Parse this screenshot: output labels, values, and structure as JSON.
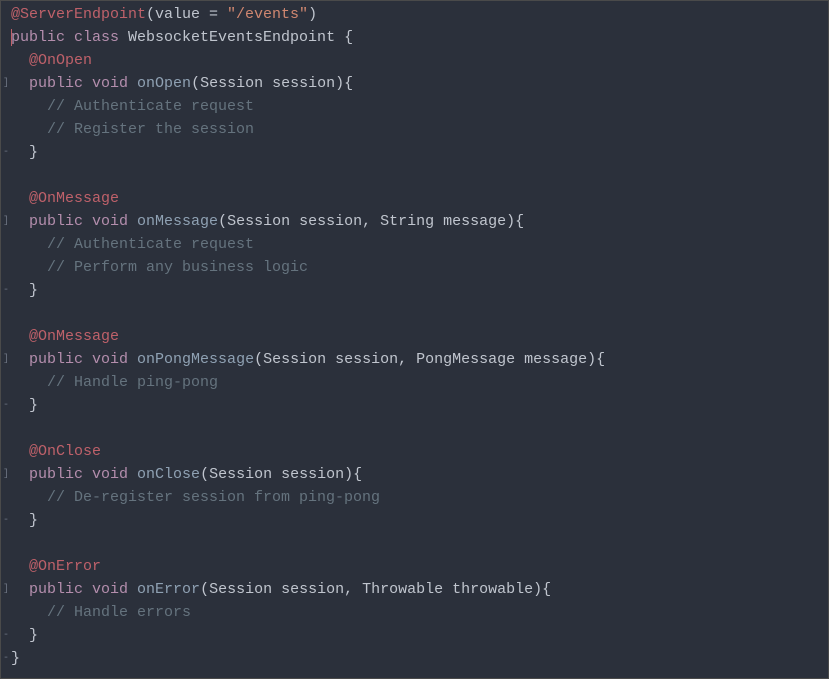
{
  "code": {
    "lines": [
      {
        "tokens": [
          {
            "cls": "tok-annot",
            "t": "@ServerEndpoint"
          },
          {
            "cls": "tok-punct",
            "t": "(value = "
          },
          {
            "cls": "tok-str",
            "t": "\"/events\""
          },
          {
            "cls": "tok-punct",
            "t": ")"
          }
        ],
        "gutter": ""
      },
      {
        "tokens": [
          {
            "cls": "tok-kw",
            "t": "public class "
          },
          {
            "cls": "tok-type",
            "t": "WebsocketEventsEndpoint "
          },
          {
            "cls": "tok-punct",
            "t": "{"
          }
        ],
        "gutter": "",
        "cursor": true
      },
      {
        "tokens": [
          {
            "cls": "tok-annot",
            "t": "  @OnOpen"
          }
        ],
        "gutter": ""
      },
      {
        "tokens": [
          {
            "cls": "tok-punct",
            "t": "  "
          },
          {
            "cls": "tok-kw",
            "t": "public void "
          },
          {
            "cls": "tok-method",
            "t": "onOpen"
          },
          {
            "cls": "tok-punct",
            "t": "(Session session){"
          }
        ],
        "gutter": "]"
      },
      {
        "tokens": [
          {
            "cls": "tok-comment",
            "t": "    // Authenticate request"
          }
        ],
        "gutter": ""
      },
      {
        "tokens": [
          {
            "cls": "tok-comment",
            "t": "    // Register the session"
          }
        ],
        "gutter": ""
      },
      {
        "tokens": [
          {
            "cls": "tok-punct",
            "t": "  }"
          }
        ],
        "gutter": "-"
      },
      {
        "tokens": [
          {
            "cls": "tok-punct",
            "t": ""
          }
        ],
        "gutter": ""
      },
      {
        "tokens": [
          {
            "cls": "tok-annot",
            "t": "  @OnMessage"
          }
        ],
        "gutter": ""
      },
      {
        "tokens": [
          {
            "cls": "tok-punct",
            "t": "  "
          },
          {
            "cls": "tok-kw",
            "t": "public void "
          },
          {
            "cls": "tok-method",
            "t": "onMessage"
          },
          {
            "cls": "tok-punct",
            "t": "(Session session, String message){"
          }
        ],
        "gutter": "]"
      },
      {
        "tokens": [
          {
            "cls": "tok-comment",
            "t": "    // Authenticate request"
          }
        ],
        "gutter": ""
      },
      {
        "tokens": [
          {
            "cls": "tok-comment",
            "t": "    // Perform any business logic"
          }
        ],
        "gutter": ""
      },
      {
        "tokens": [
          {
            "cls": "tok-punct",
            "t": "  }"
          }
        ],
        "gutter": "-"
      },
      {
        "tokens": [
          {
            "cls": "tok-punct",
            "t": ""
          }
        ],
        "gutter": ""
      },
      {
        "tokens": [
          {
            "cls": "tok-annot",
            "t": "  @OnMessage"
          }
        ],
        "gutter": ""
      },
      {
        "tokens": [
          {
            "cls": "tok-punct",
            "t": "  "
          },
          {
            "cls": "tok-kw",
            "t": "public void "
          },
          {
            "cls": "tok-method",
            "t": "onPongMessage"
          },
          {
            "cls": "tok-punct",
            "t": "(Session session, PongMessage message){"
          }
        ],
        "gutter": "]"
      },
      {
        "tokens": [
          {
            "cls": "tok-comment",
            "t": "    // Handle ping-pong"
          }
        ],
        "gutter": ""
      },
      {
        "tokens": [
          {
            "cls": "tok-punct",
            "t": "  }"
          }
        ],
        "gutter": "-"
      },
      {
        "tokens": [
          {
            "cls": "tok-punct",
            "t": ""
          }
        ],
        "gutter": ""
      },
      {
        "tokens": [
          {
            "cls": "tok-annot",
            "t": "  @OnClose"
          }
        ],
        "gutter": ""
      },
      {
        "tokens": [
          {
            "cls": "tok-punct",
            "t": "  "
          },
          {
            "cls": "tok-kw",
            "t": "public void "
          },
          {
            "cls": "tok-method",
            "t": "onClose"
          },
          {
            "cls": "tok-punct",
            "t": "(Session session){"
          }
        ],
        "gutter": "]"
      },
      {
        "tokens": [
          {
            "cls": "tok-comment",
            "t": "    // De-register session from ping-pong"
          }
        ],
        "gutter": ""
      },
      {
        "tokens": [
          {
            "cls": "tok-punct",
            "t": "  }"
          }
        ],
        "gutter": "-"
      },
      {
        "tokens": [
          {
            "cls": "tok-punct",
            "t": ""
          }
        ],
        "gutter": ""
      },
      {
        "tokens": [
          {
            "cls": "tok-annot",
            "t": "  @OnError"
          }
        ],
        "gutter": ""
      },
      {
        "tokens": [
          {
            "cls": "tok-punct",
            "t": "  "
          },
          {
            "cls": "tok-kw",
            "t": "public void "
          },
          {
            "cls": "tok-method",
            "t": "onError"
          },
          {
            "cls": "tok-punct",
            "t": "(Session session, Throwable throwable){"
          }
        ],
        "gutter": "]"
      },
      {
        "tokens": [
          {
            "cls": "tok-comment",
            "t": "    // Handle errors"
          }
        ],
        "gutter": ""
      },
      {
        "tokens": [
          {
            "cls": "tok-punct",
            "t": "  }"
          }
        ],
        "gutter": "-"
      },
      {
        "tokens": [
          {
            "cls": "tok-punct",
            "t": "}"
          }
        ],
        "gutter": "-"
      }
    ]
  }
}
